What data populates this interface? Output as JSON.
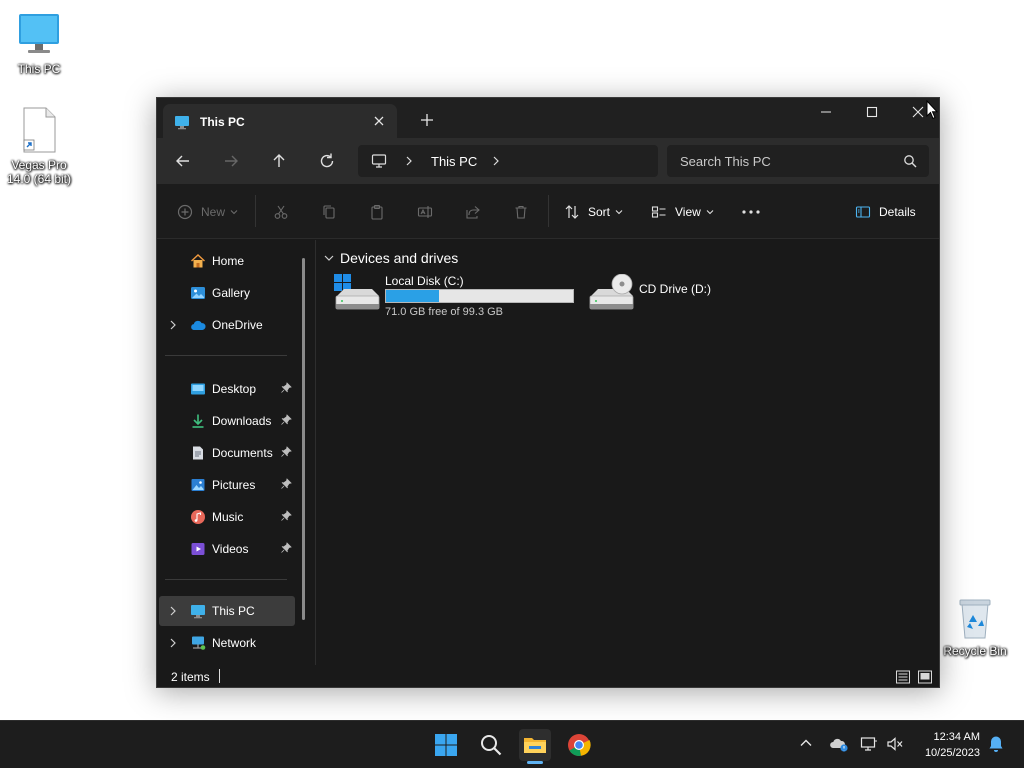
{
  "desktop": {
    "icons": [
      {
        "label": "This PC"
      },
      {
        "label": "Vegas Pro 14.0 (64 bit)"
      },
      {
        "label": "Recycle Bin"
      }
    ]
  },
  "window": {
    "tab_title": "This PC",
    "navigation": {
      "breadcrumb": [
        "This PC"
      ]
    },
    "search": {
      "placeholder": "Search This PC"
    },
    "toolbar": {
      "new_label": "New",
      "sort_label": "Sort",
      "view_label": "View",
      "details_label": "Details"
    },
    "sidebar": {
      "top_items": [
        {
          "label": "Home",
          "icon": "home-icon",
          "expandable": false
        },
        {
          "label": "Gallery",
          "icon": "gallery-icon",
          "expandable": false
        },
        {
          "label": "OneDrive",
          "icon": "onedrive-icon",
          "expandable": true
        }
      ],
      "quick_access": [
        {
          "label": "Desktop",
          "icon": "desktop-folder-icon",
          "pinned": true
        },
        {
          "label": "Downloads",
          "icon": "download-icon",
          "pinned": true
        },
        {
          "label": "Documents",
          "icon": "document-icon",
          "pinned": true
        },
        {
          "label": "Pictures",
          "icon": "picture-icon",
          "pinned": true
        },
        {
          "label": "Music",
          "icon": "music-icon",
          "pinned": true
        },
        {
          "label": "Videos",
          "icon": "video-icon",
          "pinned": true
        }
      ],
      "bottom_items": [
        {
          "label": "This PC",
          "icon": "pc-icon",
          "selected": true
        },
        {
          "label": "Network",
          "icon": "network-icon",
          "selected": false
        }
      ]
    },
    "content": {
      "group_title": "Devices and drives",
      "drives": [
        {
          "name": "Local Disk (C:)",
          "free_text": "71.0 GB free of 99.3 GB",
          "free_gb": 71.0,
          "total_gb": 99.3
        },
        {
          "name": "CD Drive (D:)"
        }
      ]
    },
    "status": {
      "item_count": "2 items"
    }
  },
  "taskbar": {
    "pinned": [
      "windows-start-icon",
      "search-icon",
      "file-explorer-icon",
      "chrome-icon"
    ],
    "clock": {
      "time": "12:34 AM",
      "date": "10/25/2023"
    }
  },
  "colors": {
    "accent": "#2aa0e6",
    "window_bg": "#191919",
    "titlebar_bg": "#202020",
    "taskbar_bg": "#1d1d1d"
  }
}
